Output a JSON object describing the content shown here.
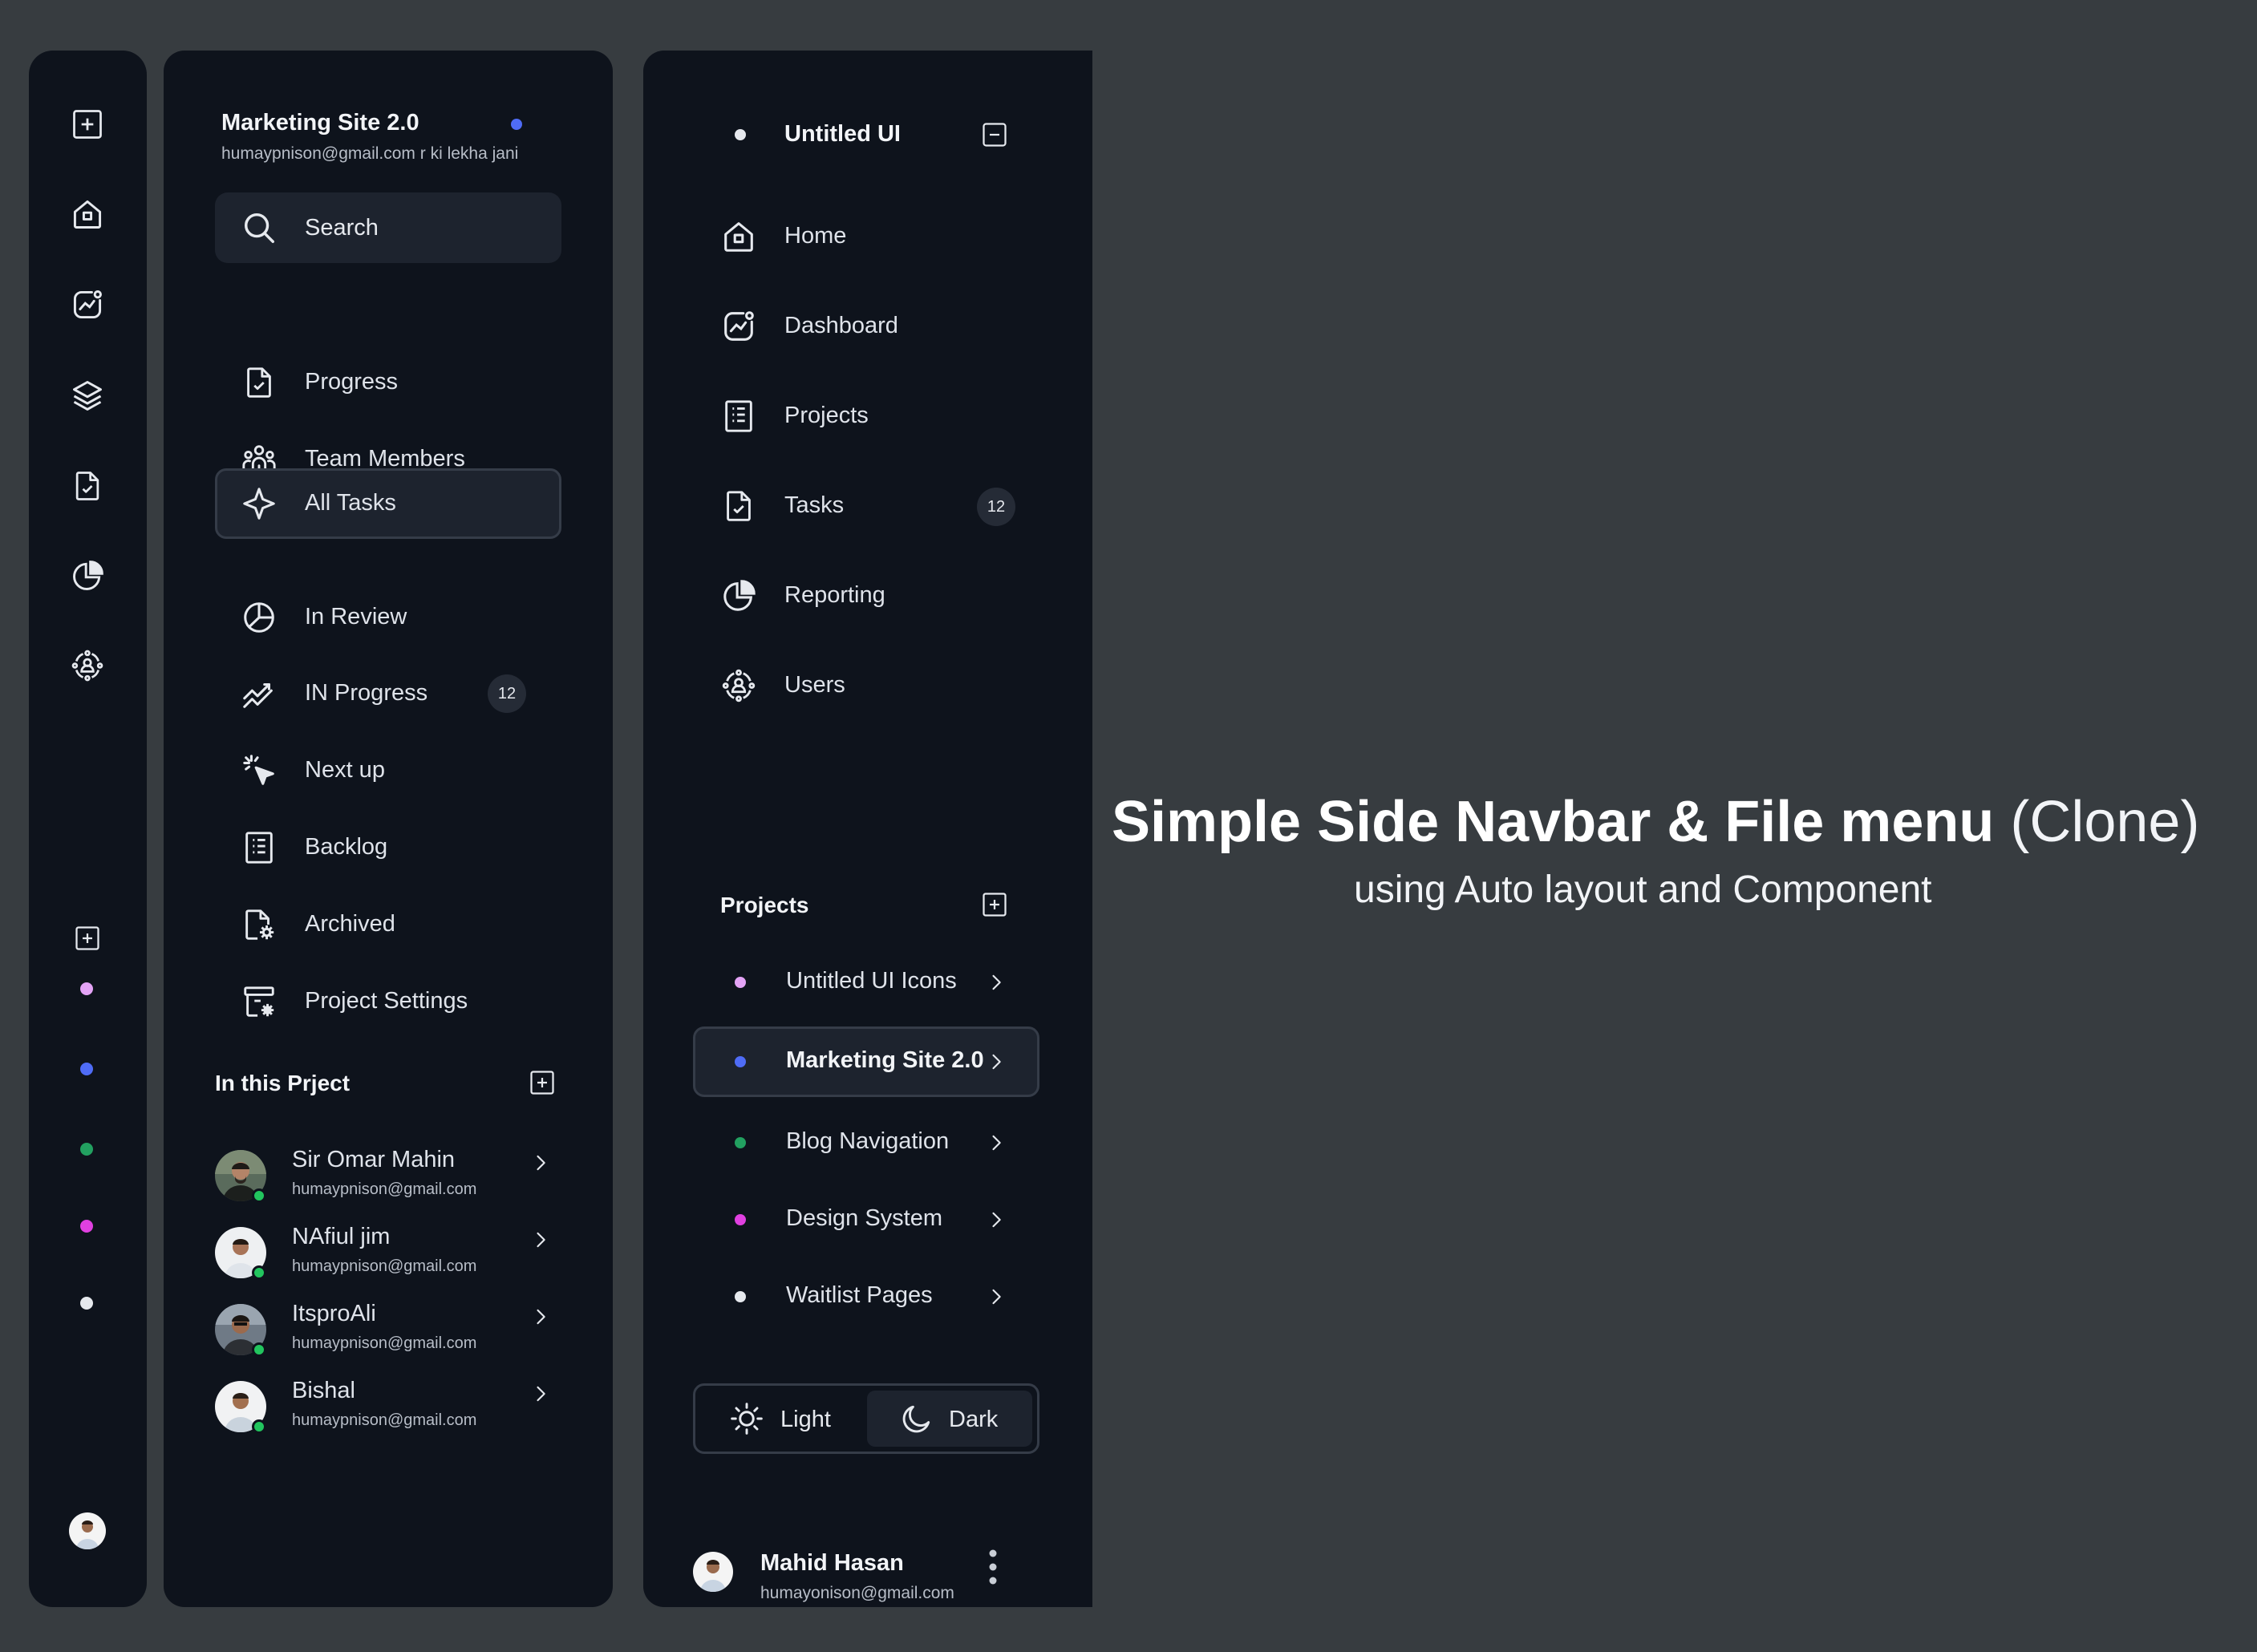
{
  "colors": {
    "background": "#373c40",
    "panel": "#0e131c",
    "active_bg": "#1d232e",
    "active_border": "#353c48",
    "online": "#22c55e"
  },
  "rail": {
    "icons": [
      "plus-square-icon",
      "home-icon",
      "chart-icon",
      "layers-icon",
      "file-check-icon",
      "pie-chart-icon",
      "user-circle-icon",
      "plus-square-icon"
    ],
    "dots": [
      "#e3a3f5",
      "#4f6cf6",
      "#22a060",
      "#e040e0",
      "#e6e9ee"
    ]
  },
  "nav": {
    "project_title": "Marketing Site 2.0",
    "project_email": "humaypnison@gmail.com r ki lekha jani",
    "search_label": "Search",
    "items": [
      {
        "label": "Progress",
        "icon": "file-check-icon"
      },
      {
        "label": "Team Members",
        "icon": "users-icon"
      },
      {
        "label": "All Tasks",
        "icon": "sparkle-icon",
        "active": true
      },
      {
        "label": "In Review",
        "icon": "pie-chart-icon"
      },
      {
        "label": "IN Progress",
        "icon": "trend-icon",
        "badge": "12"
      },
      {
        "label": "Next up",
        "icon": "cursor-click-icon"
      },
      {
        "label": "Backlog",
        "icon": "list-icon"
      },
      {
        "label": "Archived",
        "icon": "file-settings-icon"
      },
      {
        "label": "Project Settings",
        "icon": "archive-settings-icon"
      }
    ],
    "section_title": "In this Prject",
    "members": [
      {
        "name": "Sir Omar Mahin",
        "email": "humaypnison@gmail.com"
      },
      {
        "name": "NAfiul jim",
        "email": "humaypnison@gmail.com"
      },
      {
        "name": "ItsproAli",
        "email": "humaypnison@gmail.com"
      },
      {
        "name": "Bishal",
        "email": "humaypnison@gmail.com"
      }
    ]
  },
  "nav2": {
    "title": "Untitled UI",
    "items": [
      {
        "label": "Home",
        "icon": "home-icon"
      },
      {
        "label": "Dashboard",
        "icon": "chart-icon"
      },
      {
        "label": "Projects",
        "icon": "list-icon"
      },
      {
        "label": "Tasks",
        "icon": "file-check-icon",
        "badge": "12"
      },
      {
        "label": "Reporting",
        "icon": "pie-chart-icon"
      },
      {
        "label": "Users",
        "icon": "user-circle-icon"
      }
    ],
    "projects_title": "Projects",
    "projects": [
      {
        "label": "Untitled UI Icons",
        "dot": "#e3a3f5"
      },
      {
        "label": "Marketing Site 2.0",
        "dot": "#4f6cf6",
        "active": true
      },
      {
        "label": "Blog Navigation",
        "dot": "#22a060"
      },
      {
        "label": "Design System",
        "dot": "#e040e0"
      },
      {
        "label": "Waitlist Pages",
        "dot": "#e6e9ee"
      }
    ],
    "theme": {
      "light": "Light",
      "dark": "Dark",
      "selected": "Dark"
    },
    "user": {
      "name": "Mahid Hasan",
      "email": "humayonison@gmail.com"
    }
  },
  "headline": {
    "bold": "Simple Side Navbar & File menu",
    "thin": "(Clone)",
    "sub": "using Auto layout and Component"
  }
}
